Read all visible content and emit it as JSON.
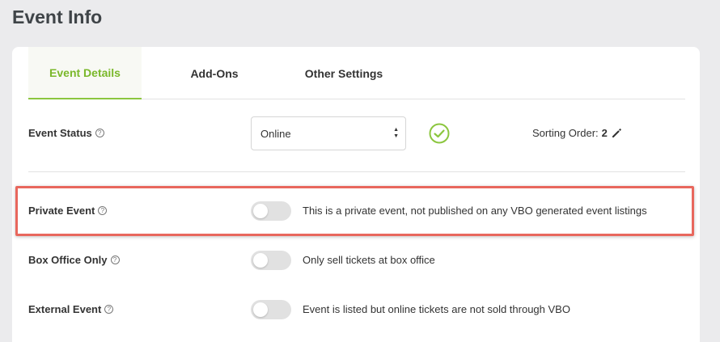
{
  "page": {
    "title": "Event Info"
  },
  "tabs": [
    {
      "label": "Event Details",
      "active": true
    },
    {
      "label": "Add-Ons",
      "active": false
    },
    {
      "label": "Other Settings",
      "active": false
    }
  ],
  "event_status": {
    "label": "Event Status",
    "selected": "Online",
    "check_icon": "check-circle-icon",
    "check_color": "#8cc63f"
  },
  "sorting": {
    "label": "Sorting Order:",
    "value": "2"
  },
  "private_event": {
    "label": "Private Event",
    "enabled": false,
    "description": "This is a private event, not published on any VBO generated event listings"
  },
  "box_office": {
    "label": "Box Office Only",
    "enabled": false,
    "description": "Only sell tickets at box office"
  },
  "external_event": {
    "label": "External Event",
    "enabled": false,
    "description": "Event is listed but online tickets are not sold through VBO"
  },
  "colors": {
    "accent": "#8cc63f",
    "highlight": "#e8675d",
    "background": "#ebebed"
  }
}
